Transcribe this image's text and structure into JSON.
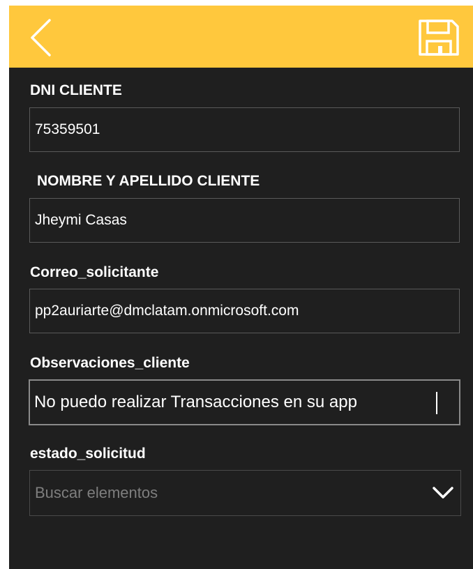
{
  "header": {
    "background": "#ffc83d",
    "back_icon": "chevron-left-icon",
    "save_icon": "floppy-disk-icon"
  },
  "form": {
    "dni": {
      "label": "DNI CLIENTE",
      "value": "75359501"
    },
    "nombre": {
      "label": "NOMBRE Y APELLIDO CLIENTE",
      "value": "Jheymi Casas"
    },
    "correo": {
      "label": "Correo_solicitante",
      "value": "pp2auriarte@dmclatam.onmicrosoft.com"
    },
    "observaciones": {
      "label": "Observaciones_cliente",
      "value": "No puedo realizar Transacciones en su app"
    },
    "estado": {
      "label": "estado_solicitud",
      "placeholder": "Buscar elementos",
      "icon": "chevron-down-icon"
    }
  },
  "colors": {
    "background": "#1f1f1f",
    "accent": "#ffc83d",
    "text": "#ffffff",
    "placeholder": "#7e7e7e",
    "border": "#5a5a5a"
  }
}
